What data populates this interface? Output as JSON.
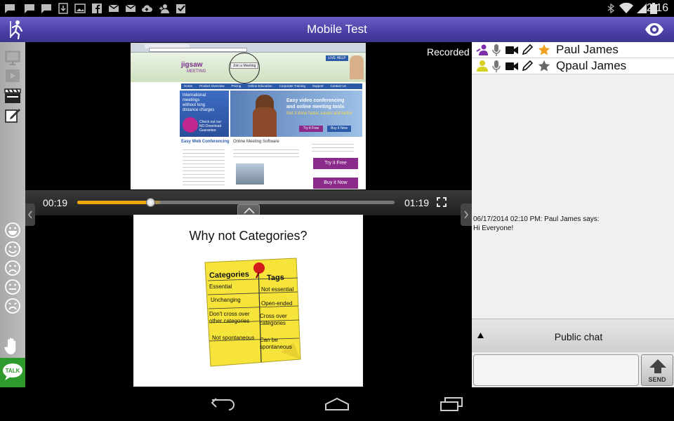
{
  "status_bar": {
    "time": "2:16",
    "notification_icons": [
      "message-icon",
      "message-icon",
      "message-icon",
      "download-icon",
      "image-icon",
      "facebook-icon",
      "email-icon",
      "email-icon",
      "cloud-upload-icon",
      "person-add-icon",
      "checkbox-icon"
    ],
    "system_icons": [
      "bluetooth-icon",
      "wifi-icon",
      "signal-icon",
      "battery-icon"
    ]
  },
  "header": {
    "title": "Mobile Test",
    "logo_icon": "running-person-icon",
    "view_icon": "eye-icon"
  },
  "left_toolbar": {
    "tools": [
      "slides-icon",
      "video-icon",
      "film-clapper-icon",
      "edit-icon"
    ],
    "emotes": [
      "laugh-icon",
      "smile-icon",
      "frown-icon",
      "neutral-icon",
      "sad-icon"
    ],
    "raise_hand_icon": "raise-hand-icon",
    "talk_label": "TALK"
  },
  "player": {
    "recorded_label": "Recorded",
    "current_time": "00:19",
    "duration": "01:19",
    "progress": 0.23,
    "buffered": 0.26,
    "accent": "#f0a80c"
  },
  "webpage": {
    "logo_text": "jigsaw",
    "logo_sub": "MEETING",
    "join_label": "Join a Meeting",
    "live_help": "LIVE HELP",
    "nav": [
      "Home",
      "Product Overview",
      "Pricing",
      "Online Education",
      "Corporate Training",
      "Support",
      "Contact Us"
    ],
    "banner_left": [
      "International",
      "meetings",
      "without long",
      "distance charges"
    ],
    "banner_left_foot": [
      "Check out our",
      "NO Download",
      "Guarantee"
    ],
    "banner_title": [
      "Easy video conferencing",
      "and online meeting tools"
    ],
    "banner_tag": "Get it done faster, easier and better",
    "try_free": "Try it Free",
    "buy_now": "Buy it Now",
    "col1_title": "Easy Web Conferencing",
    "col2_title": "Online Meeting Software",
    "side_try": "Try it Free",
    "side_buy": "Buy it Now"
  },
  "slide": {
    "title": "Why not Categories?",
    "note_headers": [
      "Categories",
      "Tags"
    ],
    "note_rows": [
      [
        "Essential",
        "Not essential"
      ],
      [
        "Unchanging",
        "Open-ended"
      ],
      [
        "Don't cross over other categories",
        "Cross over categories"
      ],
      [
        "Not spontaneous",
        "Can be spontaneous"
      ]
    ]
  },
  "users": [
    {
      "name": "Paul James",
      "role_icon": "presenter-icon",
      "role_color": "#7b2fa8"
    },
    {
      "name": "Qpaul James",
      "role_icon": "person-icon",
      "role_color": "#d8d020"
    }
  ],
  "chat": {
    "messages": [
      {
        "header": "06/17/2014 02:10 PM: Paul James says:",
        "text": "Hi Everyone!"
      }
    ],
    "channel": "Public chat",
    "send_label": "SEND"
  },
  "colors": {
    "title_bar": "#5046b0",
    "talk_button": "#2e9a2e",
    "star": "#f0a020"
  }
}
